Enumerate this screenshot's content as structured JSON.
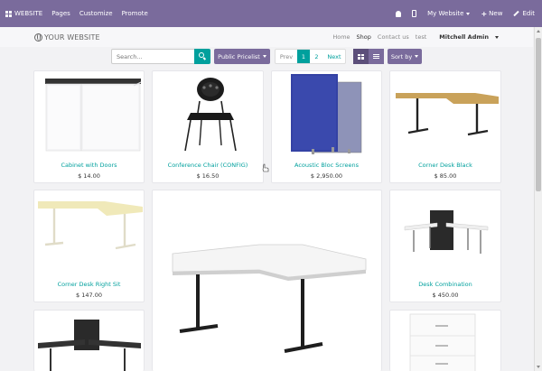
{
  "topbar": {
    "app_label": "WEBSITE",
    "menu": [
      "Pages",
      "Customize",
      "Promote"
    ],
    "site_selector": "My Website",
    "new_label": "New",
    "edit_label": "Edit",
    "color": "#7a6b9c"
  },
  "header": {
    "logo": "YOUR WEBSITE",
    "nav": [
      "Home",
      "Shop",
      "Contact us",
      "test"
    ],
    "user": "Mitchell Admin"
  },
  "toolbar": {
    "search_placeholder": "Search...",
    "pricelist": "Public Pricelist",
    "pager": {
      "prev": "Prev",
      "pages": [
        "1",
        "2"
      ],
      "current": "1",
      "next": "Next"
    },
    "sort_label": "Sort by"
  },
  "products": [
    {
      "name": "Cabinet with Doors",
      "price": "$ 14.00"
    },
    {
      "name": "Conference Chair (CONFIG)",
      "price": "$ 16.50"
    },
    {
      "name": "Acoustic Bloc Screens",
      "price": "$ 2,950.00"
    },
    {
      "name": "Corner Desk Black",
      "price": "$ 85.00"
    },
    {
      "name": "Corner Desk Right Sit",
      "price": "$ 147.00"
    },
    {
      "name": "",
      "price": ""
    },
    {
      "name": "Desk Combination",
      "price": "$ 450.00"
    },
    {
      "name": "",
      "price": ""
    },
    {
      "name": "",
      "price": ""
    }
  ],
  "accent_color": "#00a09d"
}
